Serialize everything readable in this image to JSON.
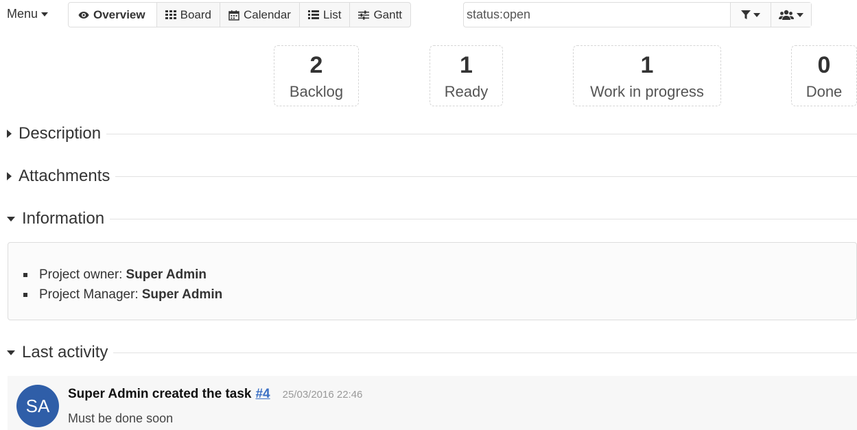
{
  "menu": {
    "label": "Menu"
  },
  "views": [
    {
      "label": "Overview",
      "icon": "eye-icon",
      "active": true
    },
    {
      "label": "Board",
      "icon": "board-grid-icon"
    },
    {
      "label": "Calendar",
      "icon": "calendar-icon"
    },
    {
      "label": "List",
      "icon": "list-icon"
    },
    {
      "label": "Gantt",
      "icon": "sliders-icon"
    }
  ],
  "search": {
    "value": "status:open"
  },
  "stats": [
    {
      "count": "2",
      "label": "Backlog"
    },
    {
      "count": "1",
      "label": "Ready"
    },
    {
      "count": "1",
      "label": "Work in progress"
    },
    {
      "count": "0",
      "label": "Done"
    }
  ],
  "sections": {
    "description": "Description",
    "attachments": "Attachments",
    "information": "Information",
    "last_activity": "Last activity"
  },
  "information": {
    "owner_label": "Project owner:",
    "owner_value": "Super Admin",
    "manager_label": "Project Manager:",
    "manager_value": "Super Admin"
  },
  "activity": {
    "avatar_initials": "SA",
    "avatar_color": "#2f5ea8",
    "title": "Super Admin created the task",
    "task_link": "#4",
    "date": "25/03/2016 22:46",
    "body": "Must be done soon"
  }
}
